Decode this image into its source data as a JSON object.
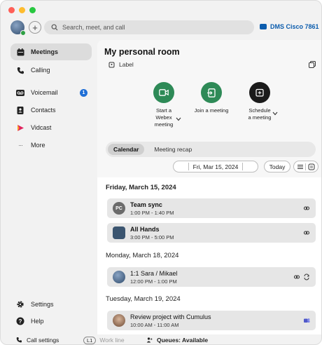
{
  "search": {
    "placeholder": "Search, meet, and call"
  },
  "device": {
    "label": "DMS Cisco 7861"
  },
  "sidebar": {
    "items": [
      {
        "label": "Meetings"
      },
      {
        "label": "Calling"
      },
      {
        "label": "Voicemail",
        "badge": "1"
      },
      {
        "label": "Contacts"
      },
      {
        "label": "Vidcast"
      },
      {
        "label": "More"
      }
    ],
    "settings_label": "Settings",
    "help_label": "Help"
  },
  "room": {
    "title": "My personal room",
    "label": "Label"
  },
  "actions": {
    "start": [
      "Start a",
      "Webex",
      "meeting"
    ],
    "join": "Join a meeting",
    "schedule": [
      "Schedule",
      "a meeting"
    ]
  },
  "tabs": {
    "calendar": "Calendar",
    "recap": "Meeting recap"
  },
  "date_nav": {
    "date": "Fri, Mar 15, 2024",
    "today": "Today"
  },
  "days": [
    {
      "header": "Friday, March 15, 2024"
    },
    {
      "header": "Monday, March 18, 2024"
    },
    {
      "header": "Tuesday, March 19, 2024"
    }
  ],
  "events": [
    {
      "title": "Team sync",
      "time": "1:00 PM  -  1:40 PM",
      "initials": "PC"
    },
    {
      "title": "All Hands",
      "time": "3:00 PM  -  5:00 PM"
    },
    {
      "title": "1:1 Sara / Mikael",
      "time": "12:00 PM  -  1:00 PM"
    },
    {
      "title": "Review project with Cumulus",
      "time": "10:00 AM  -  11:00 AM"
    }
  ],
  "status": {
    "call_settings": "Call settings",
    "line": "L1",
    "work_line": "Work line",
    "queues": "Queues: Available"
  },
  "colors": {
    "accent_blue": "#0b5cad",
    "green": "#2e8a57",
    "badge_blue": "#1f6fd6"
  }
}
